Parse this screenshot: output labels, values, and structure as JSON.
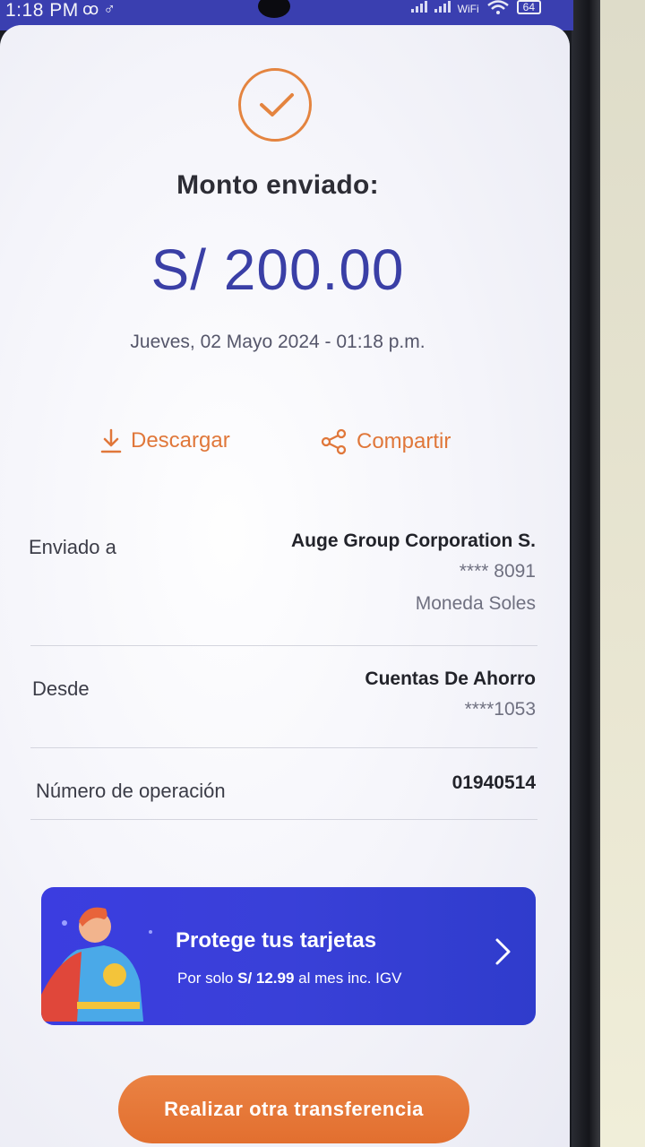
{
  "status_bar": {
    "time": "1:18 PM",
    "left_icons": "ꝏ ♂",
    "wifi_label": "WiFi",
    "battery": "64"
  },
  "receipt": {
    "title": "Monto enviado:",
    "amount": "S/ 200.00",
    "datetime": "Jueves, 02 Mayo 2024 - 01:18 p.m."
  },
  "actions": {
    "download_label": "Descargar",
    "share_label": "Compartir"
  },
  "details": {
    "sent_to": {
      "label": "Enviado a",
      "name": "Auge Group Corporation S.",
      "account": "**** 8091",
      "currency": "Moneda Soles"
    },
    "from": {
      "label": "Desde",
      "name": "Cuentas De Ahorro",
      "account": "****1053"
    },
    "operation": {
      "label": "Número de operación",
      "number": "01940514"
    }
  },
  "promo": {
    "title": "Protege tus tarjetas",
    "subtitle_prefix": "Por solo",
    "price": "S/ 12.99",
    "subtitle_suffix": "al mes inc. IGV"
  },
  "cta": {
    "label": "Realizar otra transferencia"
  },
  "colors": {
    "accent_orange": "#e4843f",
    "amount_blue": "#3a3fa6",
    "promo_blue": "#3b3de0"
  }
}
